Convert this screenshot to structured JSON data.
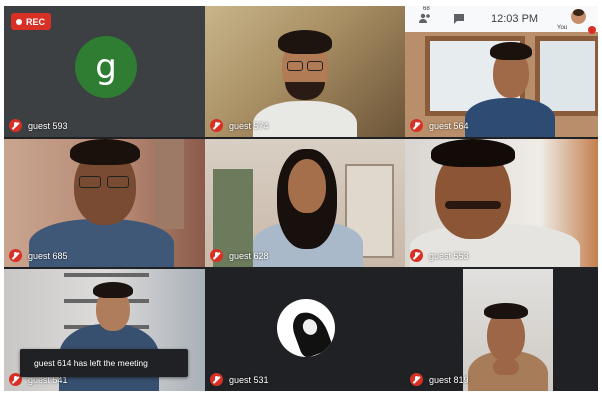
{
  "recording": {
    "label": "REC"
  },
  "topbar": {
    "participants_count": "68",
    "time": "12:03 PM",
    "you_label": "You"
  },
  "tiles": [
    {
      "name": "guest 593",
      "avatar_letter": "g"
    },
    {
      "name": "guest 574"
    },
    {
      "name": "guest 564"
    },
    {
      "name": "guest 685"
    },
    {
      "name": "guest 628"
    },
    {
      "name": "guest 553"
    },
    {
      "name": "guest 541"
    },
    {
      "name": "guest 531"
    },
    {
      "name": "guest 819"
    }
  ],
  "notification": {
    "text": "guest 614 has left the meeting"
  },
  "colors": {
    "mute_red": "#d93025",
    "avatar_green": "#2e7d32",
    "frame_bg": "#202124"
  }
}
